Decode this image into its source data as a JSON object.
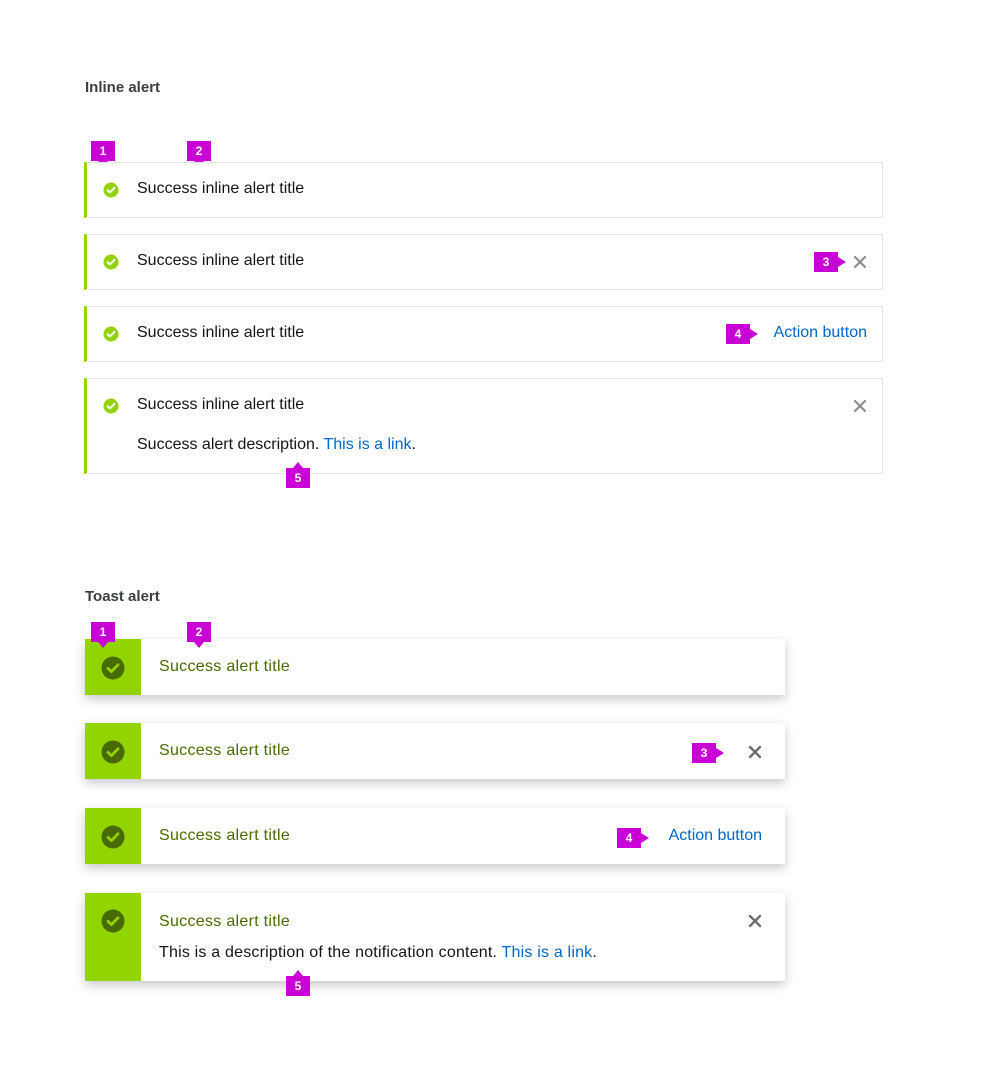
{
  "colors": {
    "success": "#92d400",
    "success_text": "#486b00",
    "link": "#0066cc",
    "marker": "#c800d6",
    "close_icon": "#8a8d90"
  },
  "icons": {
    "status": "check-circle-icon",
    "close": "close-icon"
  },
  "inline_section": {
    "heading": "Inline alert",
    "alerts": [
      {
        "title": "Success inline alert title"
      },
      {
        "title": "Success inline alert title"
      },
      {
        "title": "Success inline alert title",
        "action_label": "Action button"
      },
      {
        "title": "Success inline alert title",
        "description": "Success alert description.",
        "link_text": "This is a link",
        "trailing": "."
      }
    ]
  },
  "toast_section": {
    "heading": "Toast alert",
    "alerts": [
      {
        "title": "Success alert title"
      },
      {
        "title": "Success alert title"
      },
      {
        "title": "Success alert title",
        "action_label": "Action button"
      },
      {
        "title": "Success alert title",
        "description": "This is a description of the notification content.",
        "link_text": "This is a link",
        "trailing": "."
      }
    ]
  },
  "markers": {
    "inline": [
      "1",
      "2",
      "3",
      "4",
      "5"
    ],
    "toast": [
      "1",
      "2",
      "3",
      "4",
      "5"
    ]
  }
}
